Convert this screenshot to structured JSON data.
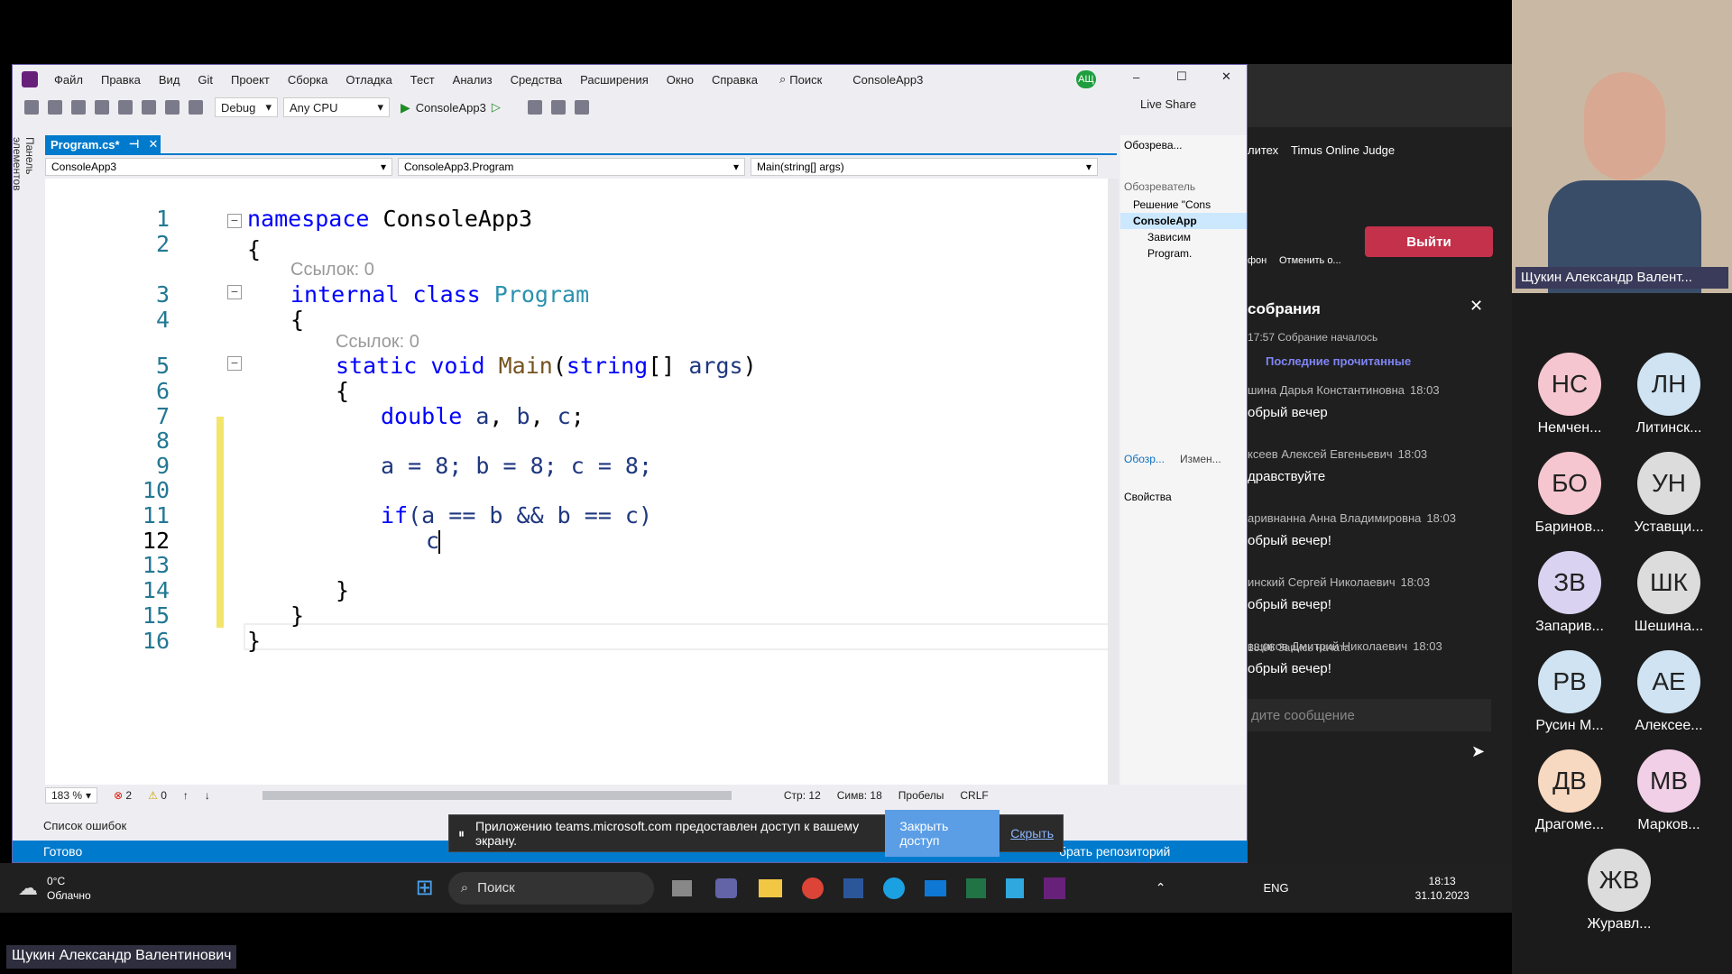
{
  "vs": {
    "menu": [
      "Файл",
      "Правка",
      "Вид",
      "Git",
      "Проект",
      "Сборка",
      "Отладка",
      "Тест",
      "Анализ",
      "Средства",
      "Расширения",
      "Окно",
      "Справка"
    ],
    "search": "Поиск",
    "solution_title": "ConsoleApp3",
    "user_initials": "АЩ",
    "config": "Debug",
    "platform": "Any CPU",
    "run_target": "ConsoleApp3",
    "live_share": "Live Share",
    "tab": "Program.cs*",
    "nav_project": "ConsoleApp3",
    "nav_class": "ConsoleApp3.Program",
    "nav_member": "Main(string[] args)",
    "toolbox_label": "Панель элементов",
    "line_numbers": [
      "1",
      "2",
      "3",
      "4",
      "5",
      "6",
      "7",
      "8",
      "9",
      "10",
      "11",
      "12",
      "13",
      "14",
      "15",
      "16"
    ],
    "refs": "Ссылок: 0",
    "code": {
      "l1a": "namespace",
      "l1b": " ConsoleApp3",
      "l2": "{",
      "l3a": "internal class ",
      "l3b": "Program",
      "l4": "{",
      "l5a": "static void ",
      "l5b": "Main",
      "l5c": "(",
      "l5d": "string",
      "l5e": "[] ",
      "l5f": "args",
      ")": ")",
      "l6": "{",
      "l7a": "double ",
      "l7b": "a",
      "l7c": ", ",
      "l7d": "b",
      "l7e": ", ",
      "l7f": "c",
      "l7g": ";",
      "l9": "a = 8; b = 8; c = 8;",
      "l11a": "if",
      "l11b": "(a == b && b == c)",
      "l12": "c",
      "l14": "}",
      "l15": "}",
      "l16": "}"
    },
    "zoom": "183 %",
    "errors": "2",
    "warnings": "0",
    "line_info": "Стр: 12",
    "col_info": "Симв: 18",
    "spaces": "Пробелы",
    "eol": "CRLF",
    "error_list": "Список ошибок",
    "status": "Готово",
    "repo": "брать репозиторий",
    "explorer": {
      "title": "Обозрева...",
      "search": "Обозреватель",
      "solution": "Решение \"Cons",
      "project": "ConsoleApp",
      "deps": "Зависим",
      "file": "Program.",
      "tab1": "Обозр...",
      "tab2": "Измен..."
    },
    "properties": "Свойства"
  },
  "share_bar": {
    "message": "Приложению teams.microsoft.com предоставлен доступ к вашему экрану.",
    "stop": "Закрыть доступ",
    "hide": "Скрыть"
  },
  "browser": {
    "bookmark1": "литех",
    "bookmark2": "Timus Online Judge"
  },
  "teams": {
    "leave": "Выйти",
    "mic_label": "фон",
    "cancel_label": "Отменить о...",
    "chat_title": "собрания",
    "meeting_started": "17:57 Собрание началось",
    "last_read": "Последние прочитанные",
    "messages": [
      {
        "name": "шина Дарья Константиновна",
        "time": "18:03",
        "text": "обрый вечер"
      },
      {
        "name": "ксеев Алексей Евгеньевич",
        "time": "18:03",
        "text": "дравствуйте"
      },
      {
        "name": "аривнанна Анна Владимировна",
        "time": "18:03",
        "text": "обрый вечер!"
      },
      {
        "name": "инский Сергей Николаевич",
        "time": "18:03",
        "text": "обрый вечер!"
      },
      {
        "name": "вщиков Дмитрий Николаевич",
        "time": "18:03",
        "text": "обрый вечер!"
      }
    ],
    "recording": "18:06 Запись начата",
    "compose": "дите сообщение"
  },
  "taskbar": {
    "temp": "0°C",
    "weather": "Облачно",
    "search": "Поиск",
    "lang": "ENG",
    "time": "18:13",
    "date": "31.10.2023"
  },
  "presenter": {
    "tile_name": "Щукин Александр Валент...",
    "full_name": "Щукин Александр Валентинович"
  },
  "participants": [
    {
      "initials": "НС",
      "name": "Немчен...",
      "color": "#f5c6cf"
    },
    {
      "initials": "ЛН",
      "name": "Литинск...",
      "color": "#cfe3f2"
    },
    {
      "initials": "БО",
      "name": "Баринов...",
      "color": "#f5c6cf"
    },
    {
      "initials": "УН",
      "name": "Уставщи...",
      "color": "#dcdcdc"
    },
    {
      "initials": "ЗВ",
      "name": "Запарив...",
      "color": "#d9d2f0"
    },
    {
      "initials": "ШК",
      "name": "Шешина...",
      "color": "#dcdcdc"
    },
    {
      "initials": "РВ",
      "name": "Русин М...",
      "color": "#cfe3f2"
    },
    {
      "initials": "АЕ",
      "name": "Алексее...",
      "color": "#cfe3f2"
    },
    {
      "initials": "ДВ",
      "name": "Драгоме...",
      "color": "#f7d8c0"
    },
    {
      "initials": "МВ",
      "name": "Марков...",
      "color": "#f1cfe6"
    },
    {
      "initials": "ЖВ",
      "name": "Журавл...",
      "color": "#dcdcdc"
    }
  ]
}
